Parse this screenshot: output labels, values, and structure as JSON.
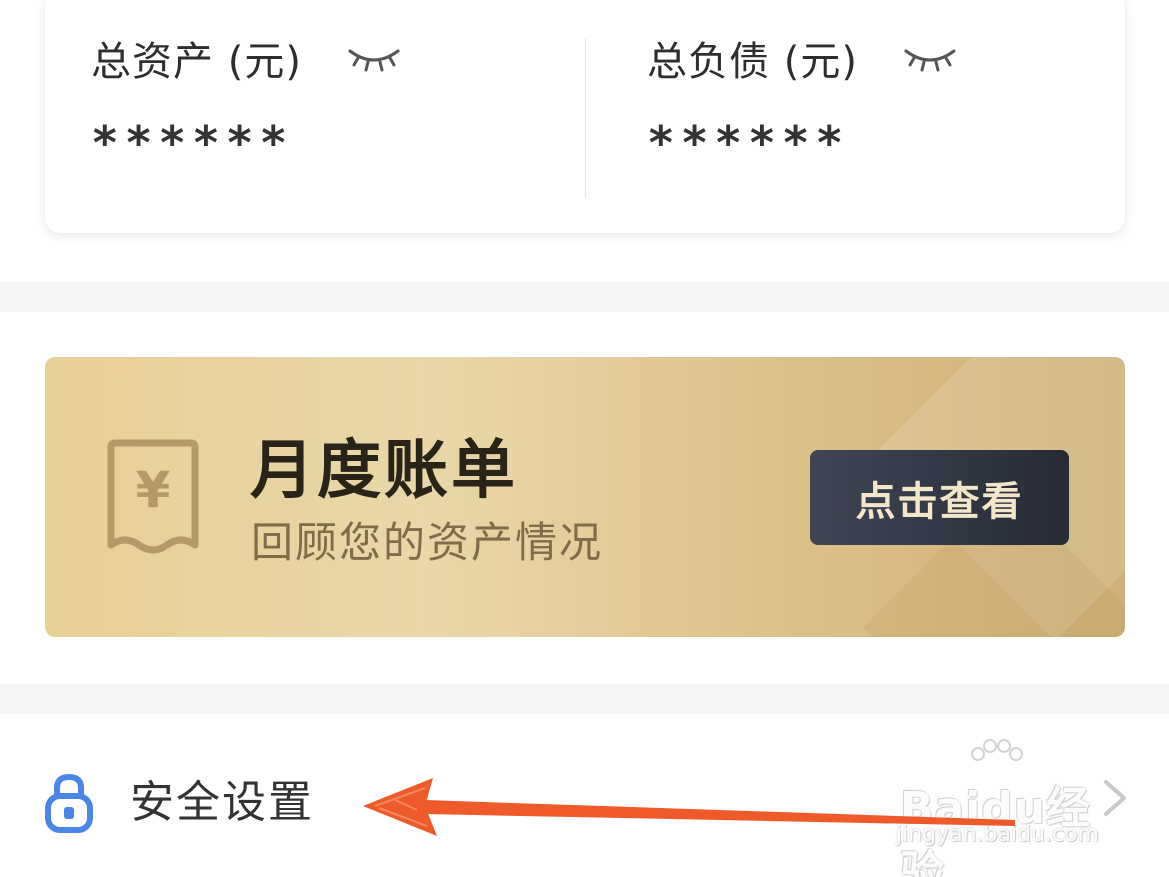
{
  "assets": {
    "total_assets_label": "总资产 (元)",
    "total_assets_value": "******",
    "total_liabilities_label": "总负债 (元)",
    "total_liabilities_value": "******"
  },
  "bill": {
    "title": "月度账单",
    "subtitle": "回顾您的资产情况",
    "button_label": "点击查看",
    "currency_symbol": "¥"
  },
  "security": {
    "label": "安全设置"
  },
  "watermark": {
    "main": "Baidu经验",
    "sub": "jingyan.baidu.com"
  },
  "colors": {
    "banner_gold": "#e7cf96",
    "button_dark": "#2f3441",
    "lock_blue": "#4a86e8",
    "annotation_red": "#ef5a2a"
  }
}
